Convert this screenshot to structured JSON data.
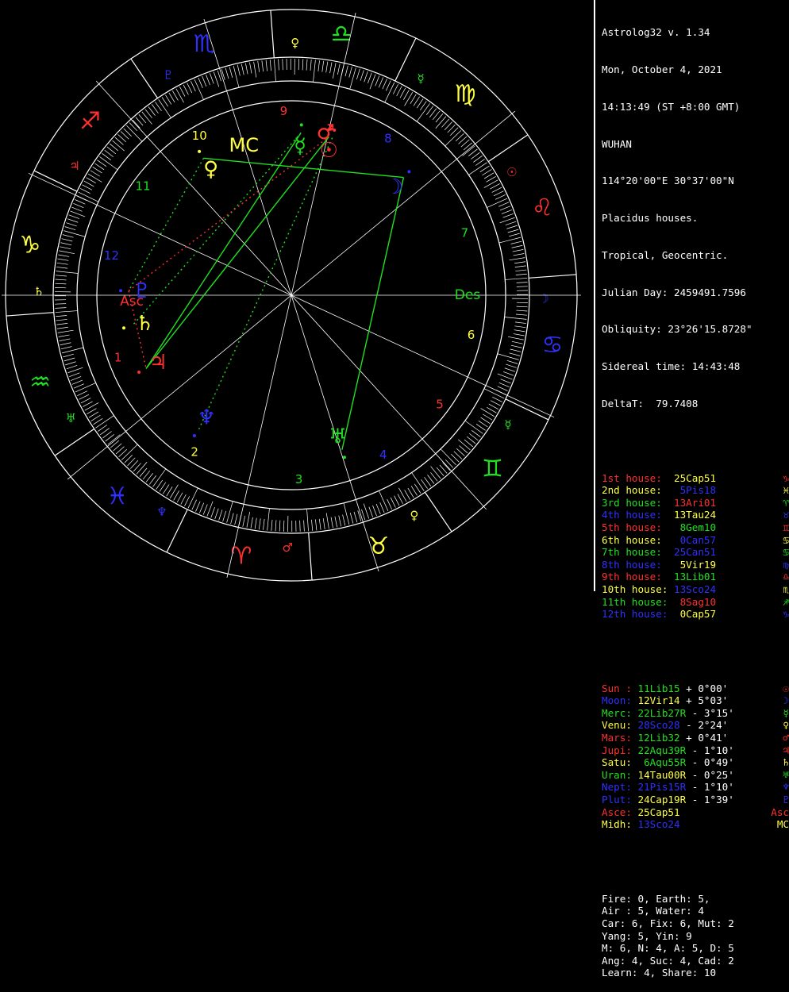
{
  "colors": {
    "background": "#000000",
    "text_white": "#ffffff",
    "fire_red": "#ff3030",
    "earth_yellow": "#ffff40",
    "air_green": "#20e020",
    "water_blue": "#3030ff"
  },
  "header": {
    "title": "Astrolog32 v. 1.34",
    "date": "Mon, October 4, 2021",
    "time": "14:13:49 (ST +8:00 GMT)",
    "place": "WUHAN",
    "coords": "114°20'00\"E 30°37'00\"N",
    "house_system": "Placidus houses.",
    "zodiac": "Tropical, Geocentric.",
    "julian_day": "Julian Day: 2459491.7596",
    "obliquity": "Obliquity: 23°26'15.8728\"",
    "sidereal": "Sidereal time: 14:43:48",
    "delta_t": "DeltaT:  79.7408"
  },
  "houses": [
    {
      "label": "1st house:",
      "value": "25Cap51",
      "glyph": "♑",
      "color": "#ff3030",
      "value_color": "#ffff40"
    },
    {
      "label": "2nd house:",
      "value": " 5Pis18",
      "glyph": "♓",
      "color": "#ffff40",
      "value_color": "#3030ff"
    },
    {
      "label": "3rd house:",
      "value": "13Ari01",
      "glyph": "♈",
      "color": "#20e020",
      "value_color": "#ff3030"
    },
    {
      "label": "4th house:",
      "value": "13Tau24",
      "glyph": "♉",
      "color": "#3030ff",
      "value_color": "#ffff40"
    },
    {
      "label": "5th house:",
      "value": " 8Gem10",
      "glyph": "♊",
      "color": "#ff3030",
      "value_color": "#20e020"
    },
    {
      "label": "6th house:",
      "value": " 0Can57",
      "glyph": "♋",
      "color": "#ffff40",
      "value_color": "#3030ff"
    },
    {
      "label": "7th house:",
      "value": "25Can51",
      "glyph": "♋",
      "color": "#20e020",
      "value_color": "#3030ff"
    },
    {
      "label": "8th house:",
      "value": " 5Vir19",
      "glyph": "♍",
      "color": "#3030ff",
      "value_color": "#ffff40"
    },
    {
      "label": "9th house:",
      "value": "13Lib01",
      "glyph": "♎",
      "color": "#ff3030",
      "value_color": "#20e020"
    },
    {
      "label": "10th house:",
      "value": "13Sco24",
      "glyph": "♏",
      "color": "#ffff40",
      "value_color": "#3030ff"
    },
    {
      "label": "11th house:",
      "value": " 8Sag10",
      "glyph": "♐",
      "color": "#20e020",
      "value_color": "#ff3030"
    },
    {
      "label": "12th house:",
      "value": " 0Cap57",
      "glyph": "♑",
      "color": "#3030ff",
      "value_color": "#ffff40"
    }
  ],
  "planets": [
    {
      "label": "Sun :",
      "pos": "11Lib15",
      "lat": " + 0°00'",
      "glyph": "☉",
      "color": "#ff3030",
      "pos_color": "#20e020"
    },
    {
      "label": "Moon:",
      "pos": "12Vir14",
      "lat": " + 5°03'",
      "glyph": "☽",
      "color": "#3030ff",
      "pos_color": "#ffff40"
    },
    {
      "label": "Merc:",
      "pos": "22Lib27R",
      "lat": " - 3°15'",
      "glyph": "☿",
      "color": "#20e020",
      "pos_color": "#20e020"
    },
    {
      "label": "Venu:",
      "pos": "28Sco28",
      "lat": " - 2°24'",
      "glyph": "♀",
      "color": "#ffff40",
      "pos_color": "#3030ff"
    },
    {
      "label": "Mars:",
      "pos": "12Lib32",
      "lat": " + 0°41'",
      "glyph": "♂",
      "color": "#ff3030",
      "pos_color": "#20e020"
    },
    {
      "label": "Jupi:",
      "pos": "22Aqu39R",
      "lat": " - 1°10'",
      "glyph": "♃",
      "color": "#ff3030",
      "pos_color": "#20e020"
    },
    {
      "label": "Satu:",
      "pos": " 6Aqu55R",
      "lat": " - 0°49'",
      "glyph": "♄",
      "color": "#ffff40",
      "pos_color": "#20e020"
    },
    {
      "label": "Uran:",
      "pos": "14Tau00R",
      "lat": " - 0°25'",
      "glyph": "♅",
      "color": "#20e020",
      "pos_color": "#ffff40"
    },
    {
      "label": "Nept:",
      "pos": "21Pis15R",
      "lat": " - 1°10'",
      "glyph": "♆",
      "color": "#3030ff",
      "pos_color": "#3030ff"
    },
    {
      "label": "Plut:",
      "pos": "24Cap19R",
      "lat": " - 1°39'",
      "glyph": "♇",
      "color": "#3030ff",
      "pos_color": "#ffff40"
    },
    {
      "label": "Asce:",
      "pos": "25Cap51",
      "lat": "",
      "glyph": "Asc",
      "color": "#ff3030",
      "pos_color": "#ffff40"
    },
    {
      "label": "Midh:",
      "pos": "13Sco24",
      "lat": "",
      "glyph": "MC",
      "color": "#ffff40",
      "pos_color": "#3030ff"
    }
  ],
  "stats": [
    "Fire: 0, Earth: 5,",
    "Air : 5, Water: 4",
    "Car: 6, Fix: 6, Mut: 2",
    "Yang: 5, Yin: 9",
    "M: 6, N: 4, A: 5, D: 5",
    "Ang: 4, Suc: 4, Cad: 2",
    "Learn: 4, Share: 10"
  ],
  "wheel": {
    "house_numbers": [
      "1",
      "2",
      "3",
      "4",
      "5",
      "6",
      "7",
      "8",
      "9",
      "10",
      "11",
      "12"
    ],
    "angle_labels": {
      "asc": "Asc",
      "des": "Des",
      "mc": "MC"
    },
    "zodiac_signs": [
      {
        "glyph": "♑",
        "color": "#ffff40",
        "ruler": "♄",
        "ruler_color": "#ffff40"
      },
      {
        "glyph": "♒",
        "color": "#20e020",
        "ruler": "♅",
        "ruler_color": "#20e020"
      },
      {
        "glyph": "♓",
        "color": "#3030ff",
        "ruler": "♆",
        "ruler_color": "#3030ff"
      },
      {
        "glyph": "♈",
        "color": "#ff3030",
        "ruler": "♂",
        "ruler_color": "#ff3030"
      },
      {
        "glyph": "♉",
        "color": "#ffff40",
        "ruler": "♀",
        "ruler_color": "#ffff40"
      },
      {
        "glyph": "♊",
        "color": "#20e020",
        "ruler": "☿",
        "ruler_color": "#20e020"
      },
      {
        "glyph": "♋",
        "color": "#3030ff",
        "ruler": "☽",
        "ruler_color": "#3030ff"
      },
      {
        "glyph": "♌",
        "color": "#ff3030",
        "ruler": "☉",
        "ruler_color": "#ff3030"
      },
      {
        "glyph": "♍",
        "color": "#ffff40",
        "ruler": "☿",
        "ruler_color": "#20e020"
      },
      {
        "glyph": "♎",
        "color": "#20e020",
        "ruler": "♀",
        "ruler_color": "#ffff40"
      },
      {
        "glyph": "♏",
        "color": "#3030ff",
        "ruler": "♇",
        "ruler_color": "#3030ff"
      },
      {
        "glyph": "♐",
        "color": "#ff3030",
        "ruler": "♃",
        "ruler_color": "#ff3030"
      }
    ],
    "planet_markers": [
      {
        "name": "sun",
        "glyph": "☉",
        "color": "#ff3030",
        "lon": 191.25
      },
      {
        "name": "moon",
        "glyph": "☽",
        "color": "#3030ff",
        "lon": 162.23
      },
      {
        "name": "mercury",
        "glyph": "☿",
        "color": "#20e020",
        "lon": 202.45
      },
      {
        "name": "venus",
        "glyph": "♀",
        "color": "#ffff40",
        "lon": 238.47
      },
      {
        "name": "mars",
        "glyph": "♂",
        "color": "#ff3030",
        "lon": 192.53
      },
      {
        "name": "jupiter",
        "glyph": "♃",
        "color": "#ff3030",
        "lon": 322.65
      },
      {
        "name": "saturn",
        "glyph": "♄",
        "color": "#ffff40",
        "lon": 306.92
      },
      {
        "name": "uranus",
        "glyph": "♅",
        "color": "#20e020",
        "lon": 44.0
      },
      {
        "name": "neptune",
        "glyph": "♆",
        "color": "#3030ff",
        "lon": 351.25
      },
      {
        "name": "pluto",
        "glyph": "♇",
        "color": "#3030ff",
        "lon": 294.32
      }
    ]
  }
}
